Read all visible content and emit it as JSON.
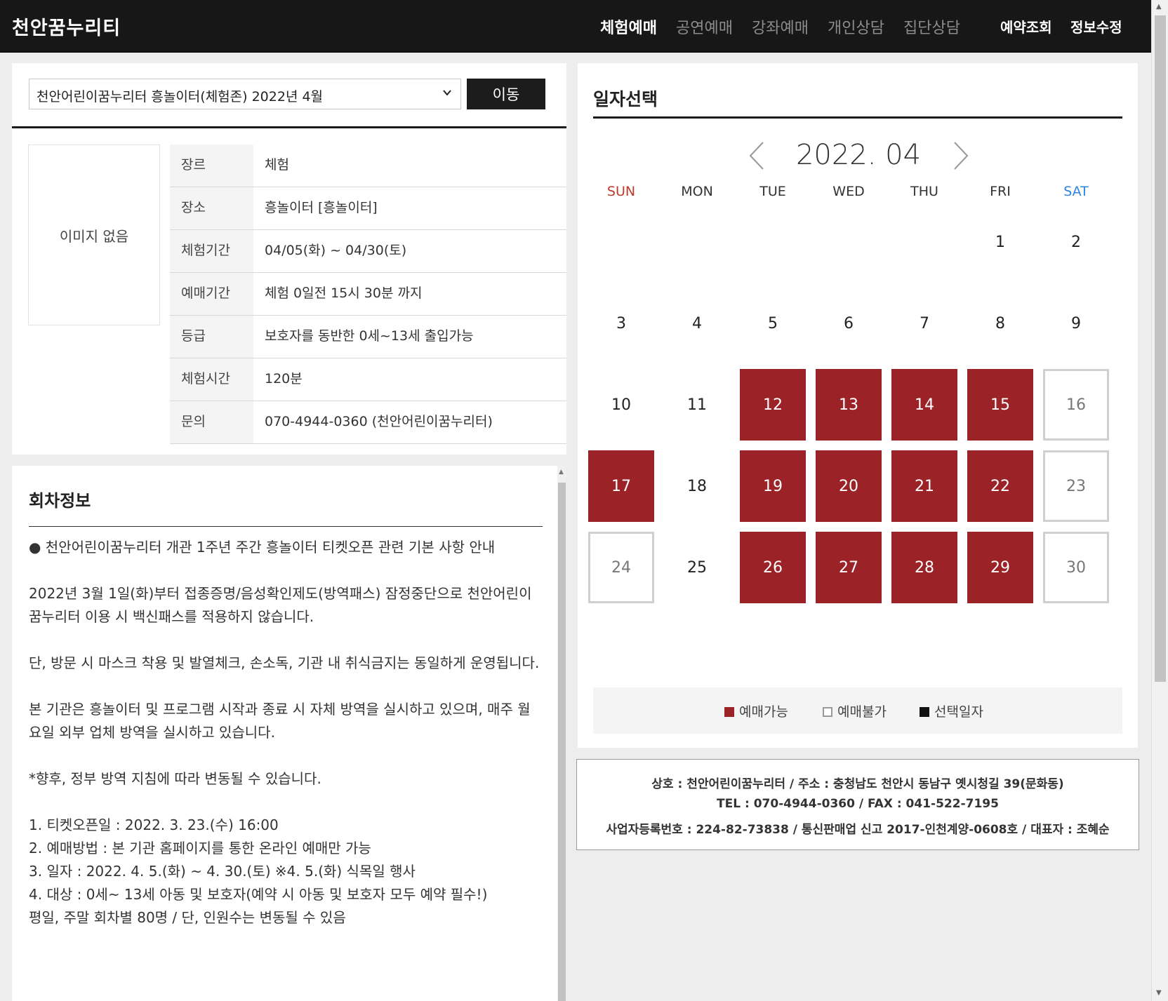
{
  "header": {
    "logo": "천안꿈누리티",
    "nav": [
      {
        "label": "체험예매",
        "state": "active"
      },
      {
        "label": "공연예매",
        "state": "normal"
      },
      {
        "label": "강좌예매",
        "state": "normal"
      },
      {
        "label": "개인상담",
        "state": "normal"
      },
      {
        "label": "집단상담",
        "state": "normal"
      },
      {
        "label": "예약조회",
        "state": "strong"
      },
      {
        "label": "정보수정",
        "state": "strong"
      }
    ]
  },
  "program": {
    "select_value": "천안어린이꿈누리터 흥놀이터(체험존) 2022년 4월",
    "go_label": "이동",
    "no_image": "이미지 없음",
    "info": [
      {
        "label": "장르",
        "value": "체험"
      },
      {
        "label": "장소",
        "value": "흥놀이터 [흥놀이터]"
      },
      {
        "label": "체험기간",
        "value": "04/05(화) ~ 04/30(토)"
      },
      {
        "label": "예매기간",
        "value": "체험 0일전 15시 30분 까지"
      },
      {
        "label": "등급",
        "value": "보호자를 동반한 0세~13세 출입가능"
      },
      {
        "label": "체험시간",
        "value": "120분"
      },
      {
        "label": "문의",
        "value": "070-4944-0360 (천안어린이꿈누리터)"
      }
    ]
  },
  "notice": {
    "title": "회차정보",
    "paragraphs": [
      "● 천안어린이꿈누리터 개관 1주년 주간 흥놀이터 티켓오픈 관련 기본 사항 안내",
      "2022년 3월 1일(화)부터 접종증명/음성확인제도(방역패스) 잠정중단으로 천안어린이꿈누리터 이용 시 백신패스를 적용하지 않습니다.",
      "단, 방문 시 마스크 착용 및 발열체크, 손소독, 기관 내 취식금지는 동일하게 운영됩니다.",
      "본 기관은 흥놀이터 및 프로그램 시작과 종료 시 자체 방역을 실시하고 있으며, 매주 월요일 외부 업체 방역을 실시하고 있습니다.",
      "*향후, 정부 방역 지침에 따라 변동될 수 있습니다."
    ],
    "items": [
      "1. 티켓오픈일 : 2022. 3. 23.(수) 16:00",
      "2. 예매방법 : 본 기관 홈페이지를 통한 온라인 예매만 가능",
      "3. 일자 : 2022. 4. 5.(화) ~ 4. 30.(토) ※4. 5.(화) 식목일 행사",
      "4. 대상 : 0세~ 13세 아동 및 보호자(예약 시 아동 및 보호자 모두 예약 필수!)",
      "평일, 주말 회차별 80명 / 단, 인원수는 변동될 수 있음"
    ]
  },
  "calendar": {
    "title": "일자선택",
    "month": "2022. 04",
    "weekdays": [
      "SUN",
      "MON",
      "TUE",
      "WED",
      "THU",
      "FRI",
      "SAT"
    ],
    "first_weekday": 5,
    "days_in_month": 30,
    "available": [
      12,
      13,
      14,
      15,
      17,
      19,
      20,
      21,
      22,
      26,
      27,
      28,
      29
    ],
    "closed": [
      16,
      23,
      24,
      30
    ],
    "colors": {
      "available": "#9b2226",
      "sunday": "#c0392b",
      "saturday": "#2e86de"
    },
    "legend": {
      "available": "예매가능",
      "closed": "예매불가",
      "selected": "선택일자"
    }
  },
  "footer": {
    "line1": "상호 : 천안어린이꿈누리터 / 주소 : 충청남도 천안시 동남구 옛시청길 39(문화동)",
    "line2": "TEL : 070-4944-0360 / FAX : 041-522-7195",
    "line3": "사업자등록번호 : 224-82-73838 / 통신판매업 신고 2017-인천계양-0608호 / 대표자 : 조혜순"
  }
}
